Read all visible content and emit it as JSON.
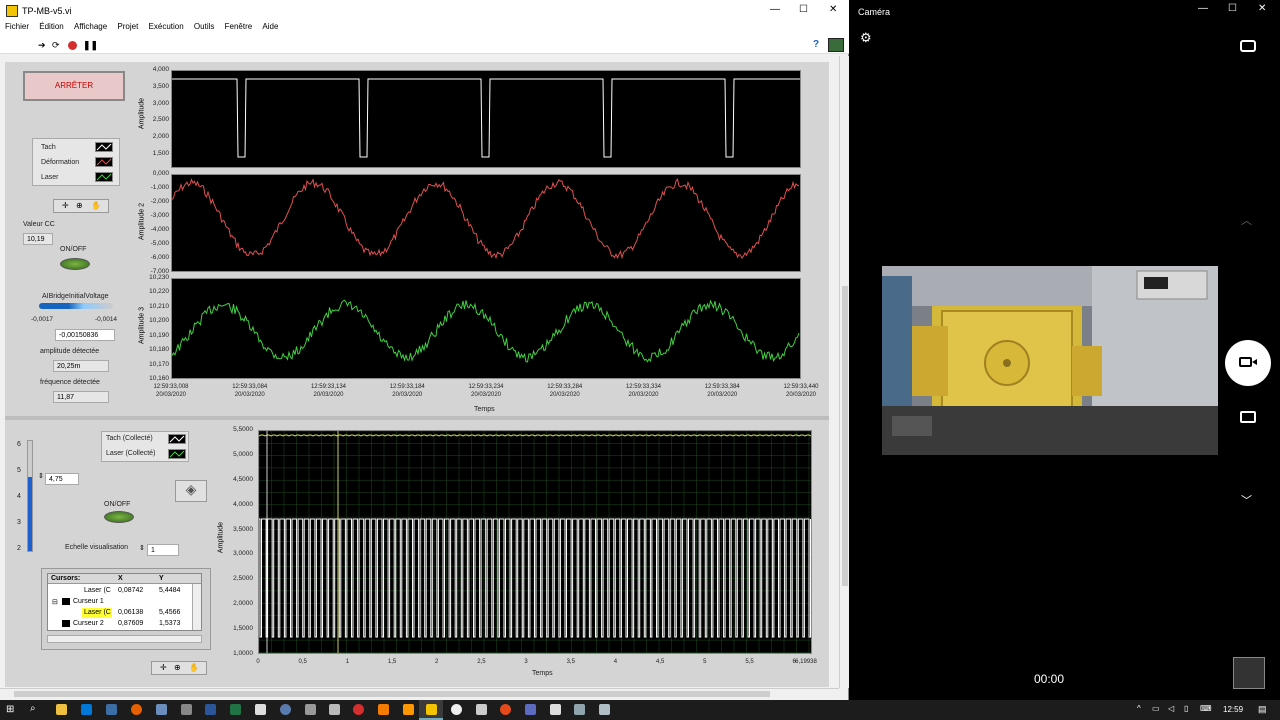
{
  "window": {
    "title": "TP-MB-v5.vi",
    "controls": {
      "min": "—",
      "max": "☐",
      "close": "✕"
    }
  },
  "menu": [
    "Fichier",
    "Édition",
    "Affichage",
    "Projet",
    "Exécution",
    "Outils",
    "Fenêtre",
    "Aide"
  ],
  "help_icon": "?",
  "stop_button": "ARRÊTER",
  "legend_top": [
    {
      "name": "Tach",
      "color": "#ffffff"
    },
    {
      "name": "Déformation",
      "color": "#e05050"
    },
    {
      "name": "Laser",
      "color": "#40d040"
    }
  ],
  "valeur_cc": {
    "label": "Valeur CC",
    "value": "10,19"
  },
  "onoff_top": "ON/OFF",
  "bridge": {
    "label": "AIBridgeInitialVoltage",
    "min": "-0,0017",
    "max": "-0,0014",
    "value": "-0,00150836"
  },
  "amplitude": {
    "label": "amplitude détectée",
    "value": "20,25m"
  },
  "frequence": {
    "label": "fréquence détectée",
    "value": "11,87"
  },
  "plot1": {
    "ylabel": "Amplitude",
    "yticks": [
      "4,000",
      "3,500",
      "3,000",
      "2,500",
      "2,000",
      "1,500"
    ]
  },
  "plot2": {
    "ylabel": "Amplitude 2",
    "yticks": [
      "0,000",
      "-1,000",
      "-2,000",
      "-3,000",
      "-4,000",
      "-5,000",
      "-6,000",
      "-7,000"
    ]
  },
  "plot3": {
    "ylabel": "Amplitude 3",
    "yticks": [
      "10,230",
      "10,220",
      "10,210",
      "10,200",
      "10,190",
      "10,180",
      "10,170",
      "10,160"
    ]
  },
  "time_axis": {
    "xlabel": "Temps",
    "ticks": [
      {
        "t": "12:59:33,008",
        "d": "20/03/2020"
      },
      {
        "t": "12:59:33,084",
        "d": "20/03/2020"
      },
      {
        "t": "12:59:33,134",
        "d": "20/03/2020"
      },
      {
        "t": "12:59:33,184",
        "d": "20/03/2020"
      },
      {
        "t": "12:59:33,234",
        "d": "20/03/2020"
      },
      {
        "t": "12:59:33,284",
        "d": "20/03/2020"
      },
      {
        "t": "12:59:33,334",
        "d": "20/03/2020"
      },
      {
        "t": "12:59:33,384",
        "d": "20/03/2020"
      },
      {
        "t": "12:59:33,440",
        "d": "20/03/2020"
      }
    ]
  },
  "slider": {
    "ticks": [
      "6",
      "5",
      "4",
      "3",
      "2"
    ],
    "value": "4,75"
  },
  "legend_bottom": [
    {
      "name": "Tach (Collecté)",
      "color": "#ffffff"
    },
    {
      "name": "Laser (Collecté)",
      "color": "#40d040"
    }
  ],
  "onoff_bottom": "ON/OFF",
  "echelle": {
    "label": "Echelle visualisation",
    "value": "1"
  },
  "cursors": {
    "headers": [
      "Cursors:",
      "X",
      "Y"
    ],
    "rows": [
      {
        "name": "Laser (C",
        "x": "0,08742",
        "y": "5,4484"
      },
      {
        "name": "Curseur 1",
        "x": "",
        "y": ""
      },
      {
        "name": "Laser (C",
        "x": "0,06138",
        "y": "5,4566"
      },
      {
        "name": "Curseur 2",
        "x": "0,87609",
        "y": "1,5373"
      }
    ]
  },
  "plot4": {
    "ylabel": "Amplitude",
    "xlabel": "Temps",
    "yticks": [
      "5,5000",
      "5,0000",
      "4,5000",
      "4,0000",
      "3,5000",
      "3,0000",
      "2,5000",
      "2,0000",
      "1,5000",
      "1,0000"
    ],
    "xticks": [
      "0",
      "0,5",
      "1",
      "1,5",
      "2",
      "2,5",
      "3",
      "3,5",
      "4",
      "4,5",
      "5",
      "5,5",
      "6",
      "6,19938"
    ]
  },
  "camera": {
    "title": "Caméra",
    "timer": "00:00"
  },
  "taskbar": {
    "time": "12:59"
  }
}
